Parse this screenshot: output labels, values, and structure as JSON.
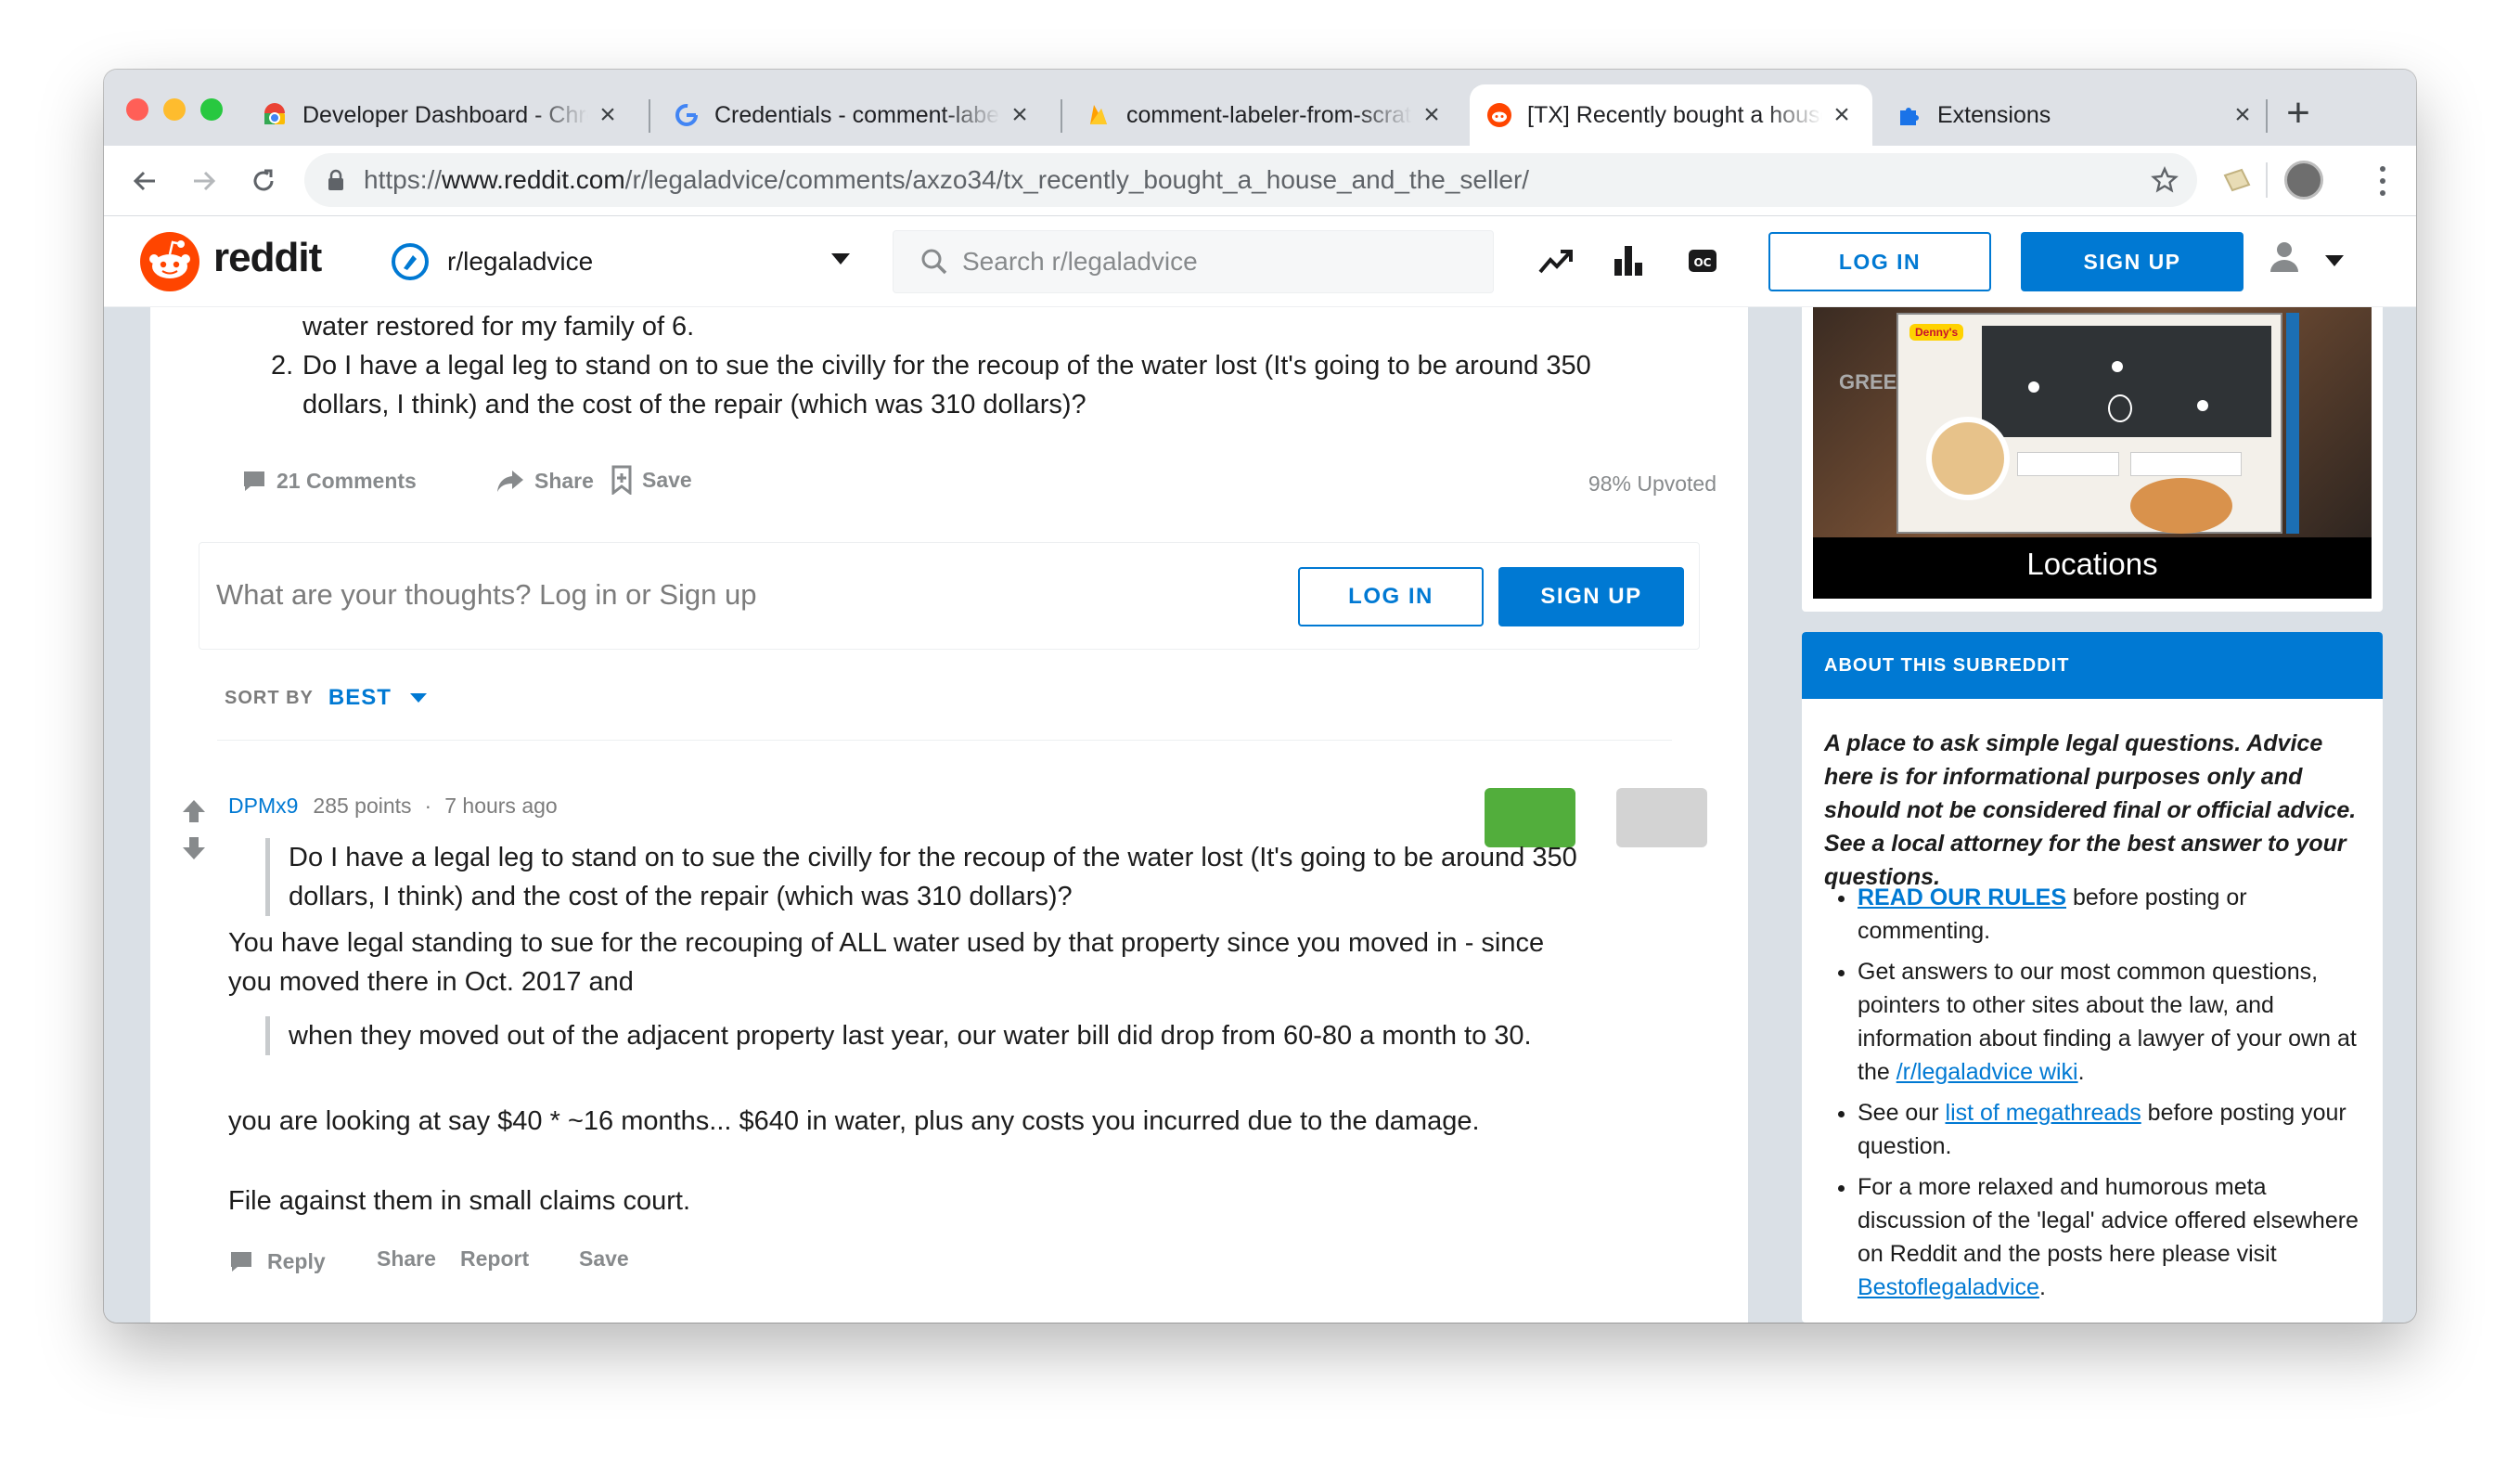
{
  "browser": {
    "tabs": [
      {
        "title": "Developer Dashboard - Chrome Web Store",
        "icon": "chrome-webstore-icon"
      },
      {
        "title": "Credentials - comment-labeler",
        "icon": "google-icon"
      },
      {
        "title": "comment-labeler-from-scratch",
        "icon": "firebase-icon"
      },
      {
        "title": "[TX] Recently bought a house and the seller",
        "icon": "reddit-icon"
      },
      {
        "title": "Extensions",
        "icon": "puzzle-icon"
      }
    ],
    "active_tab": 3,
    "url_prefix": "https://",
    "url_host": "www.reddit.com",
    "url_path": "/r/legaladvice/comments/axzo34/tx_recently_bought_a_house_and_the_seller/"
  },
  "header": {
    "logo_text": "reddit",
    "subreddit": "r/legaladvice",
    "search_placeholder": "Search r/legaladvice",
    "login_label": "LOG IN",
    "signup_label": "SIGN UP"
  },
  "post": {
    "text_tail": "water restored for my family of 6.",
    "list_item_number": "2.",
    "list_item_text": "Do I have a legal leg to stand on to sue the civilly for the recoup of the water lost (It's going to be around 350 dollars, I think) and the cost of the repair (which was 310 dollars)?",
    "comments_label": "21 Comments",
    "share_label": "Share",
    "save_label": "Save",
    "upvoted_label": "98% Upvoted"
  },
  "comment_box": {
    "placeholder": "What are your thoughts? Log in or Sign up",
    "login_label": "LOG IN",
    "signup_label": "SIGN UP"
  },
  "sort": {
    "label": "SORT BY",
    "value": "BEST"
  },
  "comment": {
    "author": "DPMx9",
    "points": "285 points",
    "separator": "·",
    "time": "7 hours ago",
    "quote1": "Do I have a legal leg to stand on to sue the civilly for the recoup of the water lost (It's going to be around 350 dollars, I think) and the cost of the repair (which was 310 dollars)?",
    "para1": "You have legal standing to sue for the recouping of ALL water used by that property since you moved in - since you moved there in Oct. 2017 and",
    "quote2": "when they moved out of the adjacent property last year, our water bill did drop from 60-80 a month to 30.",
    "para2": "you are looking at say $40 * ~16 months... $640 in water, plus any costs you incurred due to the damage.",
    "para3": "File against them in small claims court.",
    "actions": {
      "reply": "Reply",
      "share": "Share",
      "report": "Report",
      "save": "Save"
    },
    "label_colors": {
      "green": "#52ae3c",
      "gray": "#d3d3d3"
    }
  },
  "ad": {
    "brand": "Denny's",
    "caption": "Locations",
    "side_text": "GREE"
  },
  "about": {
    "title": "ABOUT THIS SUBREDDIT",
    "description": "A place to ask simple legal questions. Advice here is for informational purposes only and should not be considered final or official advice. See a local attorney for the best answer to your questions.",
    "rules_link": "READ OUR RULES",
    "rules_rest": " before posting or commenting.",
    "item2_text": "Get answers to our most common questions, pointers to other sites about the law, and information about finding a lawyer of your own at the ",
    "item2_link": "/r/legaladvice wiki",
    "item2_end": ".",
    "item3_pre": "See our ",
    "item3_link": "list of megathreads",
    "item3_rest": " before posting your question.",
    "item4_text": "For a more relaxed and humorous meta discussion of the 'legal' advice offered elsewhere on Reddit and the posts here please visit ",
    "item4_link": "Bestoflegaladvice",
    "item4_end": "."
  },
  "colors": {
    "reddit_orange": "#ff4500",
    "reddit_blue": "#0079d3",
    "page_bg": "#dae0e6"
  }
}
